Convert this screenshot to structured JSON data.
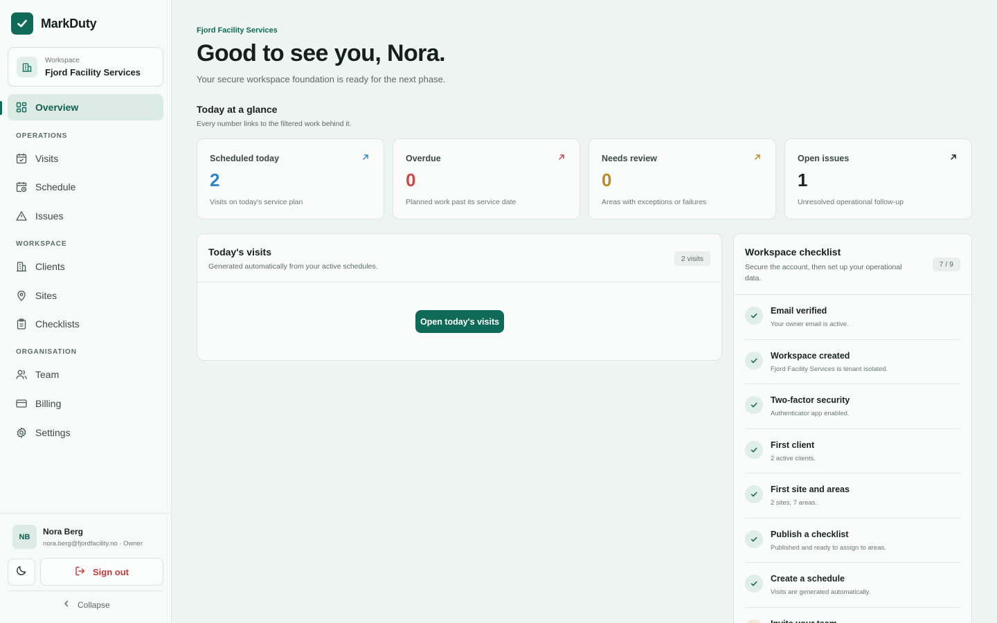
{
  "app": {
    "name": "MarkDuty"
  },
  "workspace": {
    "label": "Workspace",
    "name": "Fjord Facility Services"
  },
  "nav": {
    "overview": "Overview",
    "sections": [
      {
        "title": "OPERATIONS",
        "items": [
          {
            "label": "Visits",
            "icon": "calendar-check-icon"
          },
          {
            "label": "Schedule",
            "icon": "calendar-clock-icon"
          },
          {
            "label": "Issues",
            "icon": "warning-triangle-icon"
          }
        ]
      },
      {
        "title": "WORKSPACE",
        "items": [
          {
            "label": "Clients",
            "icon": "building-icon"
          },
          {
            "label": "Sites",
            "icon": "map-pin-icon"
          },
          {
            "label": "Checklists",
            "icon": "clipboard-icon"
          }
        ]
      },
      {
        "title": "ORGANISATION",
        "items": [
          {
            "label": "Team",
            "icon": "users-icon"
          },
          {
            "label": "Billing",
            "icon": "credit-card-icon"
          },
          {
            "label": "Settings",
            "icon": "gear-icon"
          }
        ]
      }
    ]
  },
  "user": {
    "initials": "NB",
    "name": "Nora Berg",
    "meta": "nora.berg@fjordfacility.no · Owner"
  },
  "footer": {
    "sign_out": "Sign out",
    "collapse": "Collapse"
  },
  "main": {
    "kicker": "Fjord Facility Services",
    "greeting": "Good to see you, Nora.",
    "subline": "Your secure workspace foundation is ready for the next phase.",
    "glance_title": "Today at a glance",
    "glance_sub": "Every number links to the filtered work behind it."
  },
  "stats": [
    {
      "title": "Scheduled today",
      "value": "2",
      "desc": "Visits on today's service plan",
      "color": "#2f86c4"
    },
    {
      "title": "Overdue",
      "value": "0",
      "desc": "Planned work past its service date",
      "color": "#d04545"
    },
    {
      "title": "Needs review",
      "value": "0",
      "desc": "Areas with exceptions or failures",
      "color": "#b98a2a"
    },
    {
      "title": "Open issues",
      "value": "1",
      "desc": "Unresolved operational follow-up",
      "color": "#1a2422"
    }
  ],
  "visits": {
    "title": "Today's visits",
    "sub": "Generated automatically from your active schedules.",
    "badge": "2 visits",
    "button": "Open today's visits"
  },
  "checklist": {
    "title": "Workspace checklist",
    "sub": "Secure the account, then set up your operational data.",
    "badge": "7 / 9",
    "items": [
      {
        "name": "Email verified",
        "desc": "Your owner email is active.",
        "done": true
      },
      {
        "name": "Workspace created",
        "desc": "Fjord Facility Services is tenant isolated.",
        "done": true
      },
      {
        "name": "Two-factor security",
        "desc": "Authenticator app enabled.",
        "done": true
      },
      {
        "name": "First client",
        "desc": "2 active clients.",
        "done": true
      },
      {
        "name": "First site and areas",
        "desc": "2 sites, 7 areas.",
        "done": true
      },
      {
        "name": "Publish a checklist",
        "desc": "Published and ready to assign to areas.",
        "done": true
      },
      {
        "name": "Create a schedule",
        "desc": "Visits are generated automatically.",
        "done": true
      },
      {
        "name": "Invite your team",
        "desc": "",
        "done": false
      }
    ]
  },
  "colors": {
    "brand": "#0f6b57",
    "danger": "#c23a3a"
  }
}
